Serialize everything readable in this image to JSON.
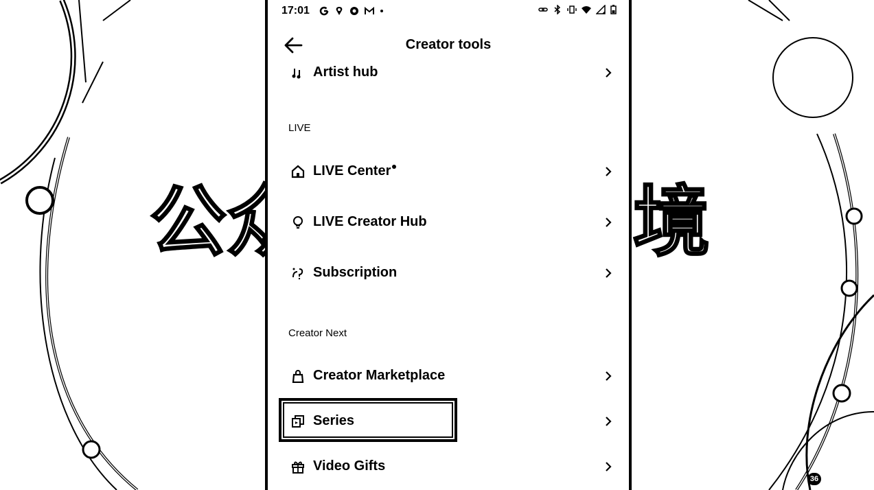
{
  "status_bar": {
    "time": "17:01",
    "app_icons": [
      "google-icon",
      "maps-icon",
      "chrome-icon",
      "gmail-icon",
      "dot-icon"
    ],
    "system_icons": [
      "link-icon",
      "bluetooth-icon",
      "vibrate-icon",
      "wifi-icon",
      "signal-icon",
      "battery-icon"
    ]
  },
  "header": {
    "title": "Creator tools",
    "back_icon": "arrow-left-icon"
  },
  "sections": {
    "live": "LIVE",
    "creator_next": "Creator Next"
  },
  "items": {
    "artist_hub": {
      "label": "Artist hub",
      "icon": "music-note-icon"
    },
    "live_center": {
      "label": "LIVE Center",
      "icon": "house-icon",
      "has_dot": true
    },
    "live_creator_hub": {
      "label": "LIVE Creator Hub",
      "icon": "lightbulb-icon"
    },
    "subscription": {
      "label": "Subscription",
      "icon": "sparkle-icon"
    },
    "creator_marketplace": {
      "label": "Creator Marketplace",
      "icon": "shopping-bag-icon"
    },
    "series": {
      "label": "Series",
      "icon": "series-icon",
      "highlighted": true
    },
    "video_gifts": {
      "label": "Video Gifts",
      "icon": "gift-icon"
    }
  },
  "watermark": {
    "left_text": "公众",
    "right_text": "境",
    "badge": "36"
  }
}
